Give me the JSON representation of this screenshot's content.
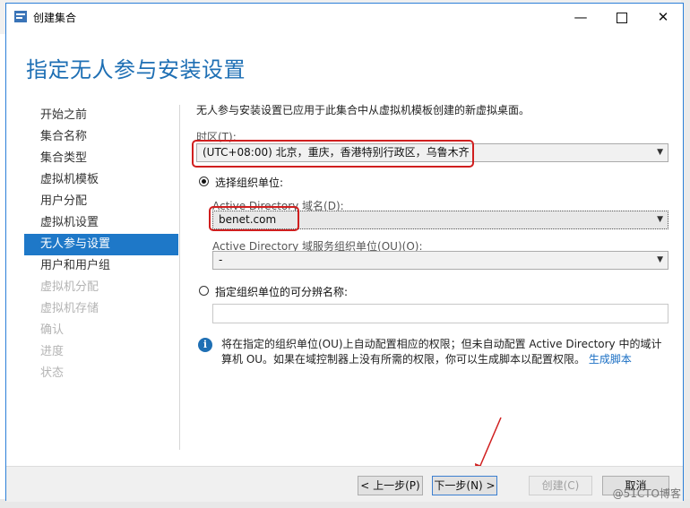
{
  "window": {
    "title": "创建集合",
    "minimize": "—",
    "close": "✕"
  },
  "page_title": "指定无人参与安装设置",
  "sidebar": {
    "items": [
      {
        "label": "开始之前",
        "state": "normal"
      },
      {
        "label": "集合名称",
        "state": "normal"
      },
      {
        "label": "集合类型",
        "state": "normal"
      },
      {
        "label": "虚拟机模板",
        "state": "normal"
      },
      {
        "label": "用户分配",
        "state": "normal"
      },
      {
        "label": "虚拟机设置",
        "state": "normal"
      },
      {
        "label": "无人参与设置",
        "state": "selected"
      },
      {
        "label": "用户和用户组",
        "state": "normal"
      },
      {
        "label": "虚拟机分配",
        "state": "disabled"
      },
      {
        "label": "虚拟机存储",
        "state": "disabled"
      },
      {
        "label": "确认",
        "state": "disabled"
      },
      {
        "label": "进度",
        "state": "disabled"
      },
      {
        "label": "状态",
        "state": "disabled"
      }
    ]
  },
  "main": {
    "description": "无人参与安装设置已应用于此集合中从虚拟机模板创建的新虚拟桌面。",
    "timezone_label": "时区(T):",
    "timezone_value": "(UTC+08:00) 北京，重庆，香港特别行政区，乌鲁木齐",
    "radio_ou_label": "选择组织单位:",
    "domain_label": "Active Directory 域名(D):",
    "domain_value": "benet.com",
    "ou_label": "Active Directory 域服务组织单位(OU)(O):",
    "ou_value": "-",
    "radio_dn_label": "指定组织单位的可分辨名称:",
    "dn_value": "",
    "info_text": "将在指定的组织单位(OU)上自动配置相应的权限；但未自动配置 Active Directory 中的域计算机 OU。如果在域控制器上没有所需的权限，你可以生成脚本以配置权限。",
    "info_link": "生成脚本"
  },
  "footer": {
    "prev_button": "< 上一步(P)",
    "next_button": "下一步(N) >",
    "create_button": "创建(C)",
    "cancel_button": "取消"
  },
  "watermark": "@51CTO博客",
  "colors": {
    "accent": "#1e78c8",
    "title": "#1e6fb4",
    "annotation": "#d01f1f"
  }
}
